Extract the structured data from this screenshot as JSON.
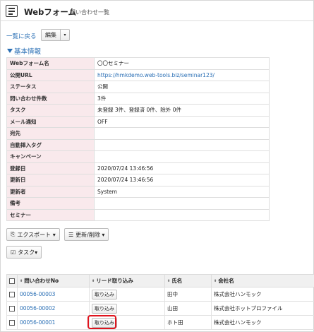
{
  "header": {
    "title": "Webフォーム",
    "subtitle": "問い合わせ一覧"
  },
  "nav": {
    "back_label": "一覧に戻る",
    "edit_label": "編集",
    "edit_caret": "▾"
  },
  "section": {
    "title": "基本情報"
  },
  "info_rows": [
    {
      "key": "Webフォーム名",
      "value": "〇〇セミナー"
    },
    {
      "key": "公開URL",
      "value": "https://hmkdemo.web-tools.biz/seminar123/"
    },
    {
      "key": "ステータス",
      "value": "公開"
    },
    {
      "key": "問い合わせ件数",
      "value": "3件"
    },
    {
      "key": "タスク",
      "value": "未登録 3件、登録済 0件、除外 0件"
    },
    {
      "key": "メール通知",
      "value": "OFF"
    },
    {
      "key": "宛先",
      "value": ""
    },
    {
      "key": "自動挿入タグ",
      "value": ""
    },
    {
      "key": "キャンペーン",
      "value": ""
    },
    {
      "key": "登録日",
      "value": "2020/07/24 13:46:56"
    },
    {
      "key": "更新日",
      "value": "2020/07/24 13:46:56"
    },
    {
      "key": "更新者",
      "value": "System"
    },
    {
      "key": "備考",
      "value": ""
    },
    {
      "key": "セミナー",
      "value": ""
    }
  ],
  "toolbar": {
    "export_label": "エクスポート",
    "update_delete_label": "更新/削除",
    "task_label": "タスク",
    "caret": "▾"
  },
  "list": {
    "headers": [
      "問い合わせNo",
      "リード取り込み",
      "氏名",
      "会社名"
    ],
    "sort_icon": "⬍",
    "rows": [
      {
        "no": "00056-00003",
        "action": "取り込み",
        "name": "田中",
        "company": "株式会社ハンモック"
      },
      {
        "no": "00056-00002",
        "action": "取り込み",
        "name": "山田",
        "company": "株式会社ホットプロファイル"
      },
      {
        "no": "00056-00001",
        "action": "取り込み",
        "name": "ホト田",
        "company": "株式会社ハンモック"
      }
    ]
  },
  "colors": {
    "link": "#2a6fb5",
    "key_bg": "#f9e9ec",
    "highlight": "#e0141e"
  },
  "icons": [
    "form-icon",
    "export-icon",
    "list-icon",
    "task-icon",
    "sort-icon"
  ]
}
